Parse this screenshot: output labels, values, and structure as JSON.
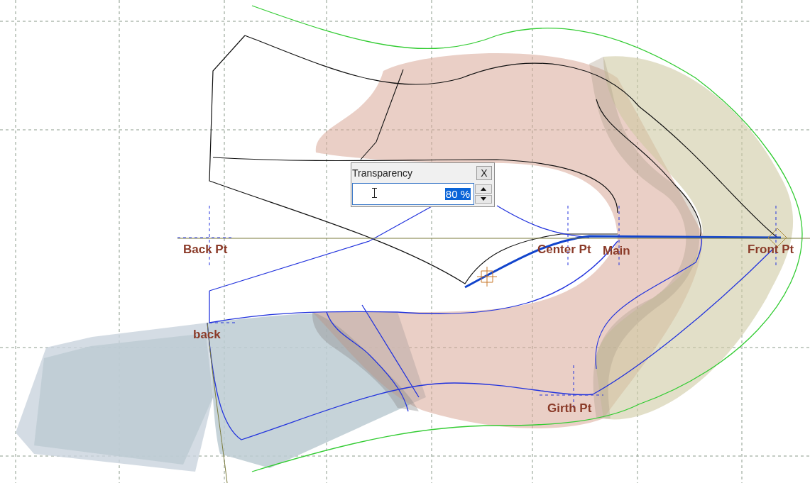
{
  "canvas": {
    "point_labels": [
      {
        "text": "Back Pt"
      },
      {
        "text": "Center Pt"
      },
      {
        "text": "Main"
      },
      {
        "text": "Front Pt"
      },
      {
        "text": "back"
      },
      {
        "text": "Girth Pt"
      }
    ]
  },
  "transparency_dialog": {
    "title": "Transparency",
    "close_button": "X",
    "value": "80 %",
    "value_selected": true
  }
}
